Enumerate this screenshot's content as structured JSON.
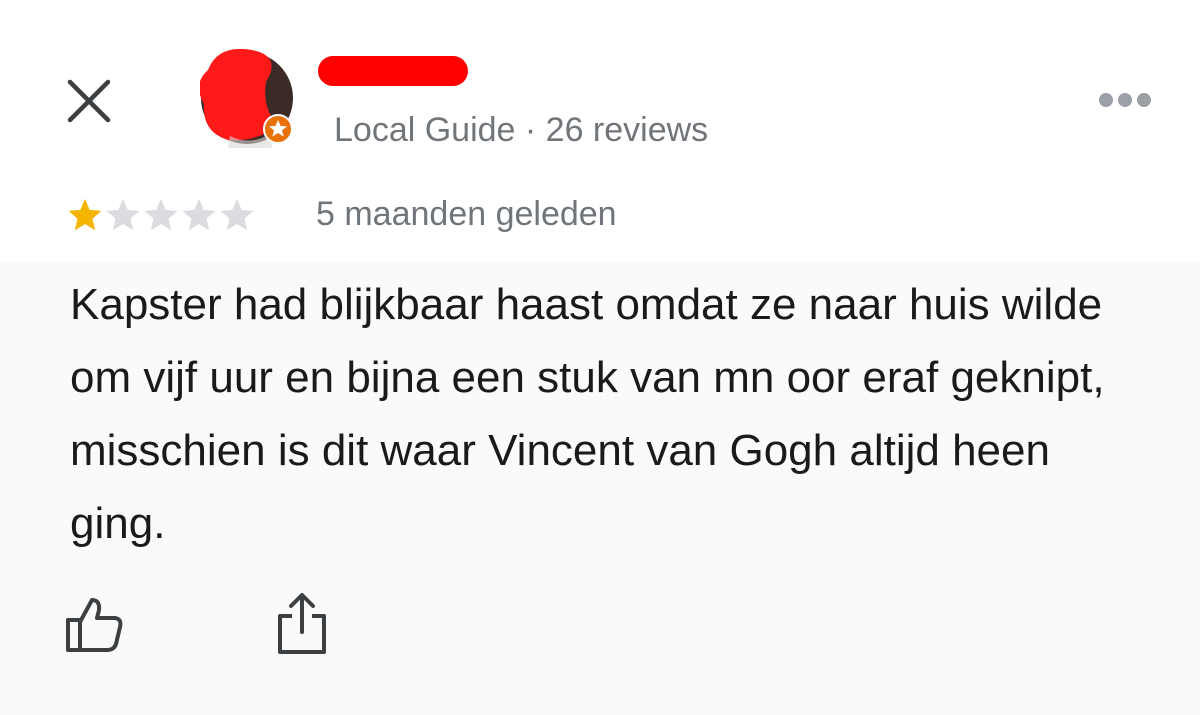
{
  "header": {
    "meta_text": "Local Guide · 26 reviews",
    "icons": {
      "close": "close-icon",
      "more": "more-options-icon",
      "badge": "local-guide-star-badge"
    }
  },
  "review": {
    "rating": 1,
    "max_rating": 5,
    "time_ago": "5 maanden geleden",
    "text": "Kapster had blijkbaar haast omdat ze naar huis wilde om vijf uur en bijna een stuk van mn oor eraf geknipt, misschien is dit waar Vincent van Gogh altijd heen ging."
  },
  "actions": {
    "icons": {
      "like": "thumbs-up-icon",
      "share": "share-icon"
    }
  },
  "colors": {
    "star_filled": "#f4b400",
    "star_empty": "#dadce0",
    "redaction": "#ff0000",
    "secondary_text": "#70757a",
    "badge": "#e8710a"
  }
}
